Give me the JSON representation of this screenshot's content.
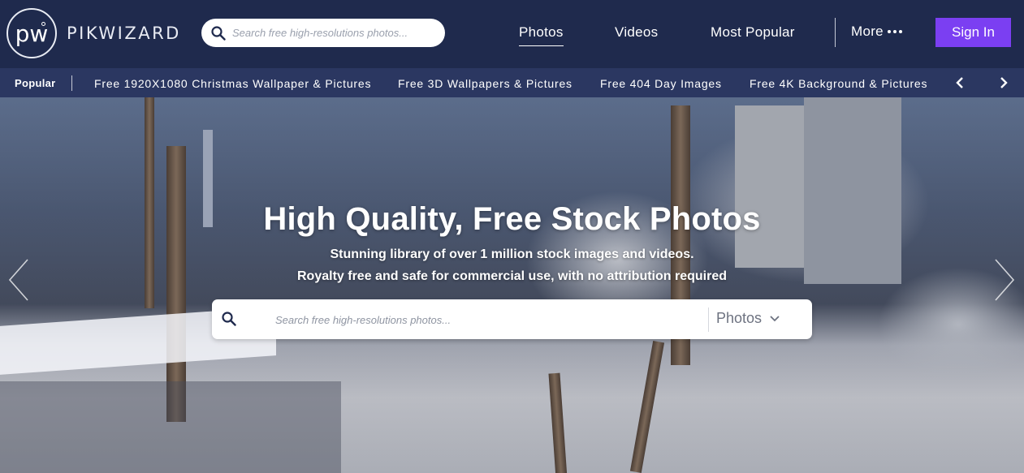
{
  "logo": {
    "mark": "pw",
    "wordmark": "PIKWIZARD"
  },
  "header_search": {
    "placeholder": "Search free high-resolutions photos...",
    "icon": "search-icon"
  },
  "nav": {
    "photos": "Photos",
    "videos": "Videos",
    "most_popular": "Most Popular",
    "more": "More",
    "sign_in": "Sign In"
  },
  "popular": {
    "label": "Popular",
    "links": [
      "Free 1920X1080 Christmas Wallpaper & Pictures",
      "Free 3D Wallpapers & Pictures",
      "Free 404 Day Images",
      "Free 4K Background & Pictures"
    ]
  },
  "hero": {
    "title": "High Quality, Free Stock Photos",
    "subtitle_1": "Stunning library of over 1 million stock images and videos.",
    "subtitle_2": "Royalty free and safe for commercial use, with no attribution required",
    "search_placeholder": "Search free high-resolutions photos...",
    "media_type": "Photos"
  },
  "colors": {
    "header_bg": "#1f2a4d",
    "popular_bar_bg": "#2b3761",
    "accent": "#7b3ff2"
  }
}
